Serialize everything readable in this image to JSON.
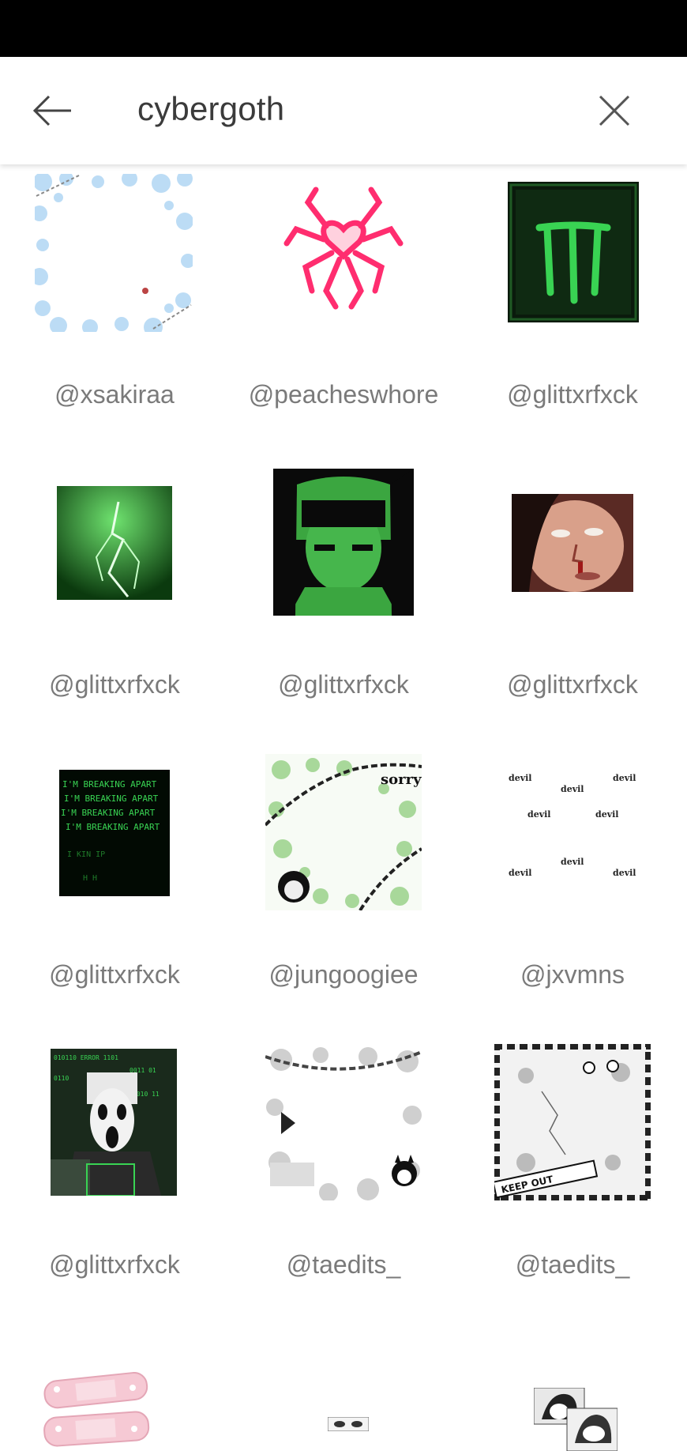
{
  "header": {
    "query": "cybergoth",
    "back_icon": "arrow-left-icon",
    "clear_icon": "close-icon"
  },
  "results": [
    {
      "handle": "@xsakiraa",
      "image": "blue-hearts-frame"
    },
    {
      "handle": "@peacheswhore",
      "image": "pink-neon-spider-heart"
    },
    {
      "handle": "@glittxrfxck",
      "image": "green-monster-claw-fridge"
    },
    {
      "handle": "@glittxrfxck",
      "image": "green-lightning"
    },
    {
      "handle": "@glittxrfxck",
      "image": "green-anime-girl"
    },
    {
      "handle": "@glittxrfxck",
      "image": "face-closeup"
    },
    {
      "handle": "@glittxrfxck",
      "image": "green-matrix-text"
    },
    {
      "handle": "@jungoogiee",
      "image": "green-chains-hearts-frame"
    },
    {
      "handle": "@jxvmns",
      "image": "devil-text-pattern"
    },
    {
      "handle": "@glittxrfxck",
      "image": "ghostface-green-code"
    },
    {
      "handle": "@taedits_",
      "image": "gray-chains-kuromi-frame"
    },
    {
      "handle": "@taedits_",
      "image": "black-white-keep-out-frame"
    },
    {
      "handle": "",
      "image": "pink-bandaids"
    },
    {
      "handle": "",
      "image": "anime-eyes-strip"
    },
    {
      "handle": "",
      "image": "manga-girls-bw"
    }
  ],
  "thumbnail_text": {
    "devil": "devil",
    "sorry": "sorry",
    "keep_out": "KEEP OUT",
    "breaking_apart": [
      "I'M BREAKING APART",
      "I'M BREAKING APART",
      "I'M BREAKING APART",
      "I'M BREAKING APART"
    ]
  },
  "colors": {
    "neon_green": "#39d353",
    "neon_pink": "#ff2d6f",
    "handle_gray": "#7a7a7a"
  }
}
